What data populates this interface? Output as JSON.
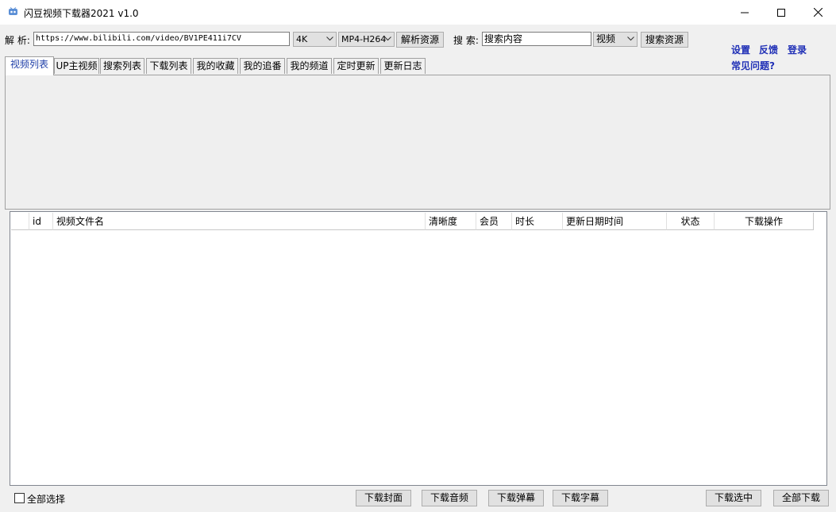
{
  "window": {
    "title": "闪豆视频下载器2021 v1.0",
    "accent_color": "#1f2fb6",
    "icon": "app-logo-icon"
  },
  "toolbar": {
    "parse_label": "解 析:",
    "url_value": "https://www.bilibili.com/video/BV1PE411i7CV",
    "quality_selected": "4K",
    "format_selected": "MP4-H264",
    "parse_button": "解析资源",
    "search_label": "搜 索:",
    "search_value": "搜索内容",
    "search_type_selected": "视频",
    "search_button": "搜索资源"
  },
  "links": {
    "settings": "设置",
    "feedback": "反馈",
    "login": "登录",
    "faq": "常见问题?"
  },
  "tabs": [
    {
      "label": "视频列表"
    },
    {
      "label": "UP主视频"
    },
    {
      "label": "搜索列表"
    },
    {
      "label": "下载列表"
    },
    {
      "label": "我的收藏"
    },
    {
      "label": "我的追番"
    },
    {
      "label": "我的频道"
    },
    {
      "label": "定时更新"
    },
    {
      "label": "更新日志"
    }
  ],
  "table": {
    "columns": [
      "",
      "id",
      "视频文件名",
      "清晰度",
      "会员",
      "时长",
      "更新日期时间",
      "状态",
      "下载操作"
    ],
    "rows": []
  },
  "footer": {
    "select_all": "全部选择",
    "download_cover": "下载封面",
    "download_audio": "下载音频",
    "download_danmaku": "下载弹幕",
    "download_subtitle": "下载字幕",
    "download_selected": "下载选中",
    "download_all": "全部下载"
  }
}
